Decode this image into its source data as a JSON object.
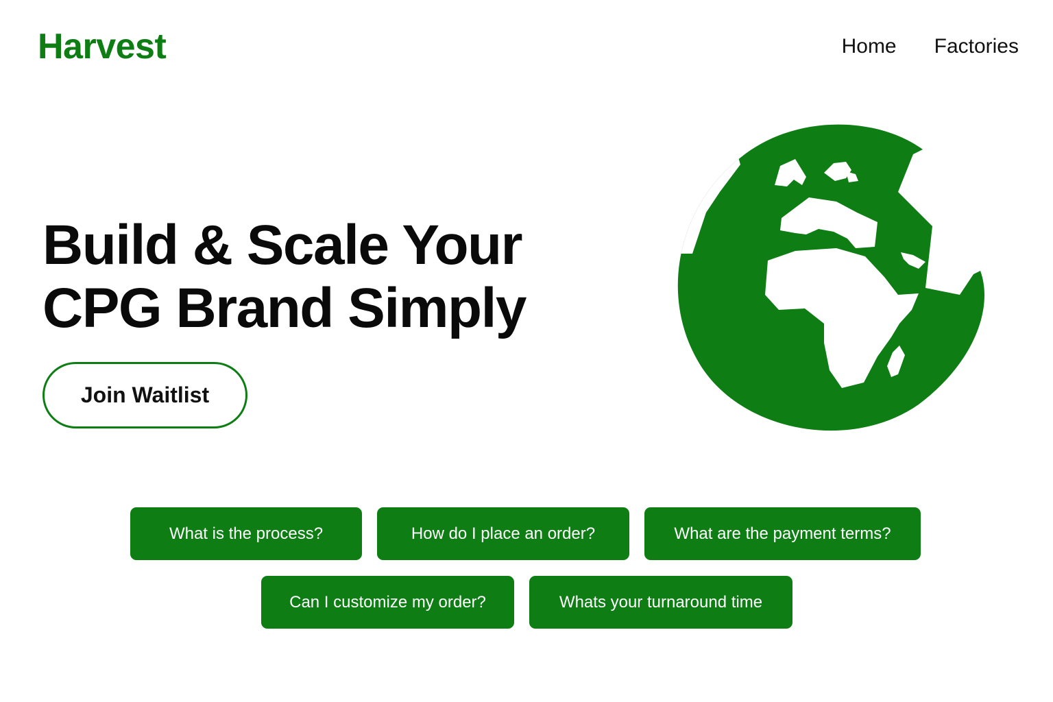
{
  "brand": {
    "name": "Harvest",
    "color": "#0d7d14"
  },
  "nav": {
    "items": [
      {
        "label": "Home"
      },
      {
        "label": "Factories"
      }
    ]
  },
  "hero": {
    "title_lines": [
      "Build & Scale Your",
      "CPG Brand Simply"
    ],
    "cta_label": "Join Waitlist",
    "illustration": "globe-icon"
  },
  "faq": {
    "questions": [
      {
        "label": "What is the process?"
      },
      {
        "label": "How do I place an order?"
      },
      {
        "label": "What are the payment terms?"
      },
      {
        "label": "Can I customize my order?"
      },
      {
        "label": "Whats your turnaround time"
      }
    ]
  },
  "colors": {
    "accent": "#0d7d14",
    "text": "#0a0a0a",
    "background": "#ffffff"
  }
}
